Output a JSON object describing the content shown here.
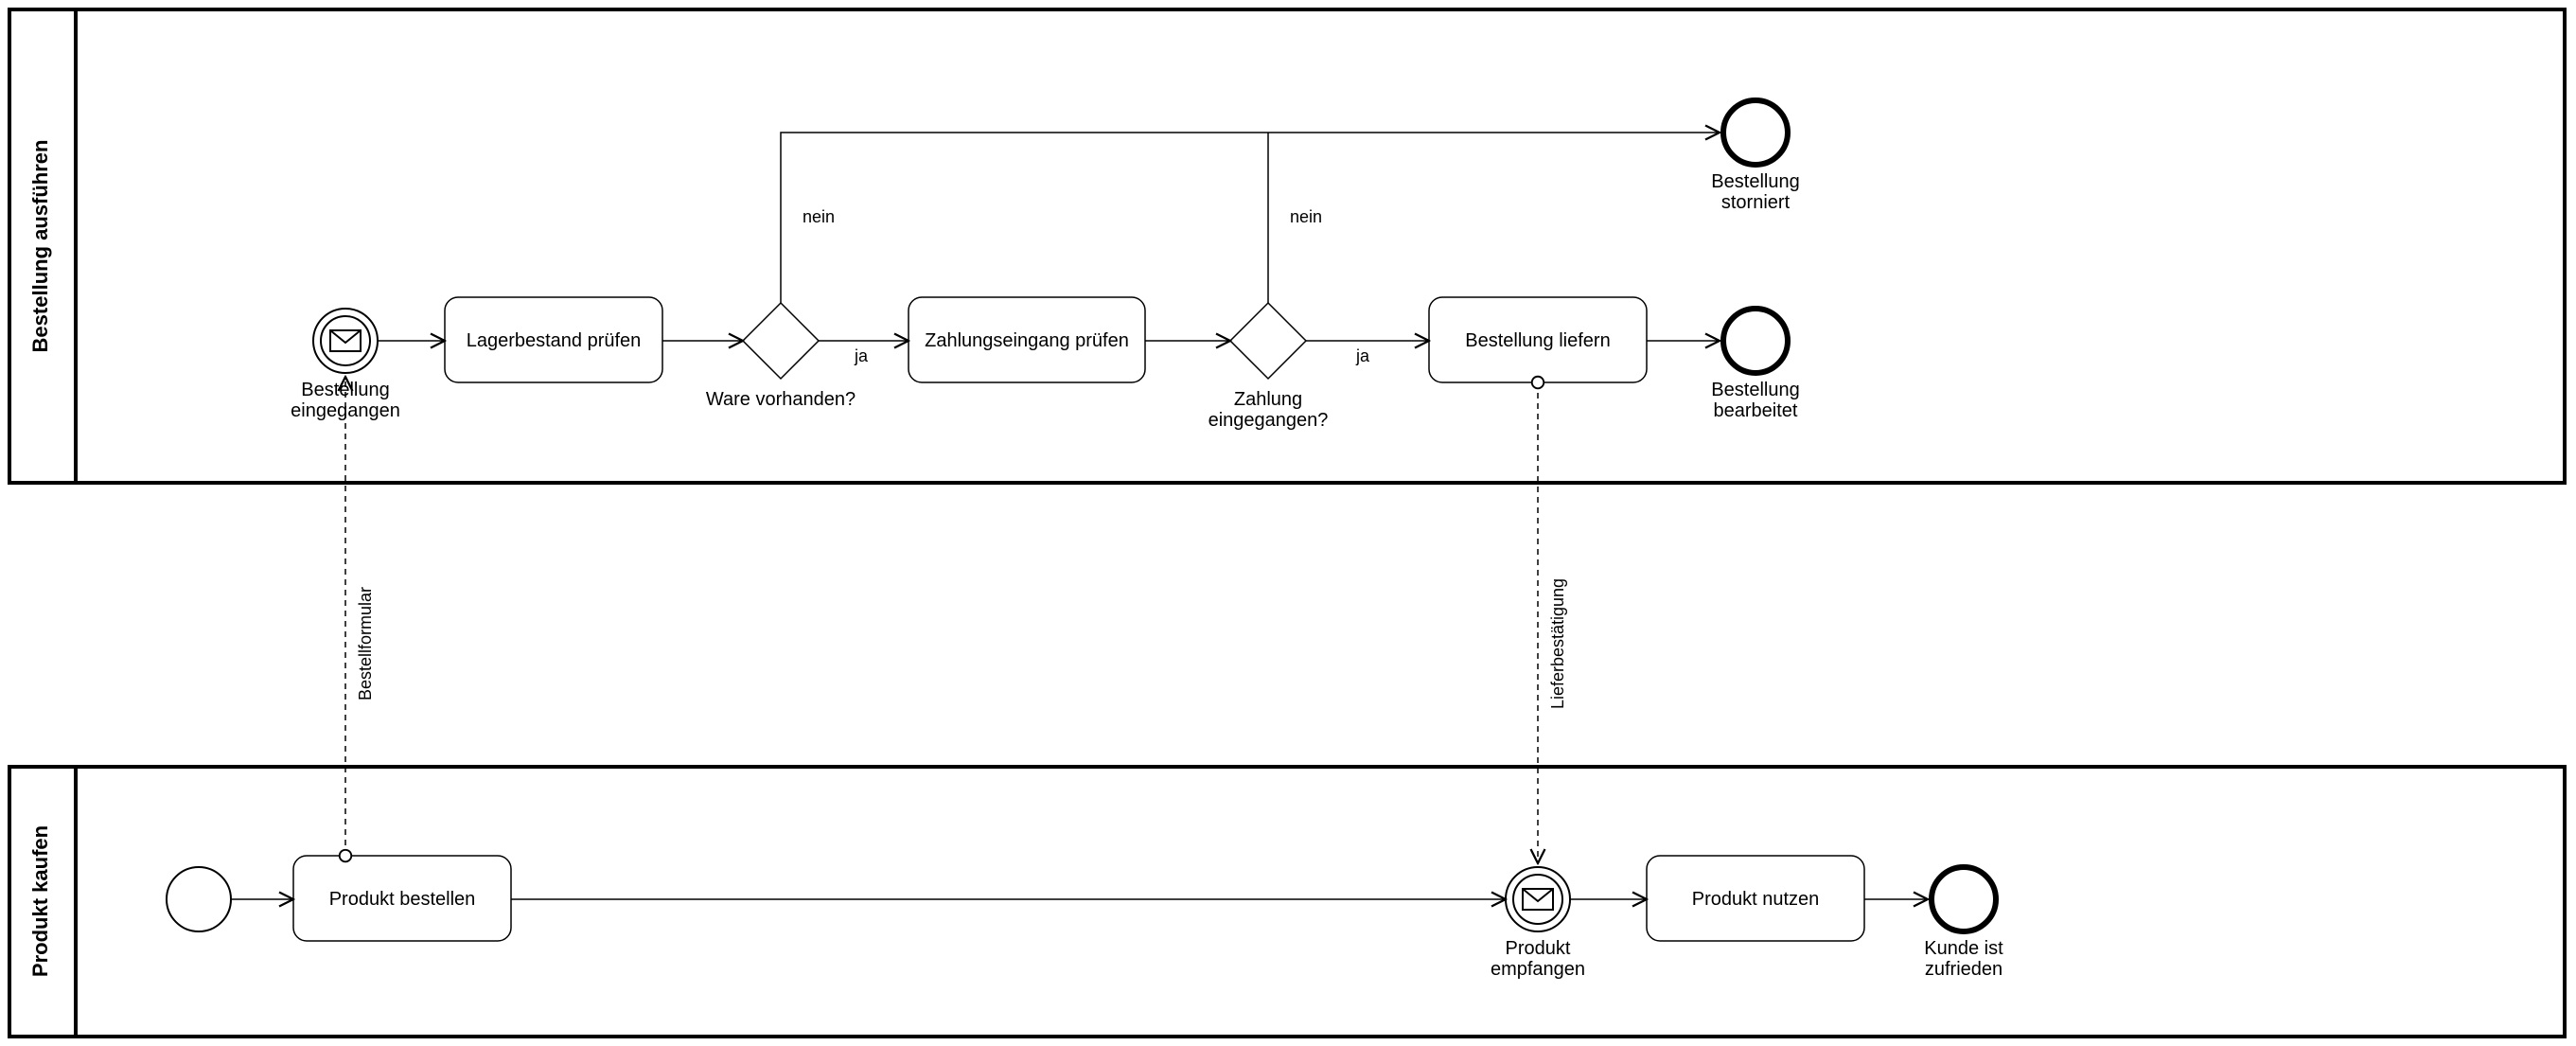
{
  "pools": {
    "top": {
      "name": "Bestellung ausführen"
    },
    "bottom": {
      "name": "Produkt kaufen"
    }
  },
  "nodes": {
    "start_top": {
      "label1": "Bestellung",
      "label2": "eingegangen"
    },
    "check_stock": {
      "label": "Lagerbestand prüfen"
    },
    "gw_stock": {
      "label": "Ware vorhanden?"
    },
    "check_payment": {
      "label": "Zahlungseingang prüfen"
    },
    "gw_payment": {
      "label1": "Zahlung",
      "label2": "eingegangen?"
    },
    "deliver": {
      "label": "Bestellung liefern"
    },
    "end_cancel": {
      "label1": "Bestellung",
      "label2": "storniert"
    },
    "end_done": {
      "label1": "Bestellung",
      "label2": "bearbeitet"
    },
    "start_bottom": {
      "label": ""
    },
    "order_product": {
      "label": "Produkt bestellen"
    },
    "recv_product": {
      "label1": "Produkt",
      "label2": "empfangen"
    },
    "use_product": {
      "label": "Produkt nutzen"
    },
    "end_happy": {
      "label1": "Kunde ist",
      "label2": "zufrieden"
    }
  },
  "edgeLabels": {
    "yes1": "ja",
    "no1": "nein",
    "yes2": "ja",
    "no2": "nein"
  },
  "messages": {
    "orderForm": "Bestellformular",
    "deliveryConf": "Lieferbestätigung"
  }
}
